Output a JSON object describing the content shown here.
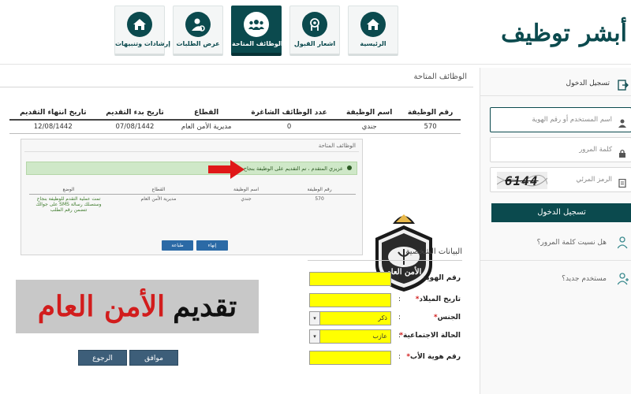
{
  "logo": {
    "part1": "أبشر",
    "part2": "توظيف"
  },
  "nav": [
    {
      "label": "الرئيسية",
      "icon": "home-icon"
    },
    {
      "label": "اشعار القبول",
      "icon": "head-icon"
    },
    {
      "label": "الوظائف المتاحة",
      "icon": "group-icon",
      "active": true
    },
    {
      "label": "عرض الطلبات",
      "icon": "user-settings-icon"
    },
    {
      "label": "إرشادات وتنبيهات",
      "icon": "home-icon"
    }
  ],
  "main": {
    "title": "الوظائف المتاحة",
    "table": {
      "headers": [
        "رقم الوظيفة",
        "اسم الوظيفة",
        "عدد الوظائف الشاغرة",
        "القطاع",
        "تاريخ بدء التقديم",
        "تاريخ انتهاء التقديم"
      ],
      "row": [
        "570",
        "جندي",
        "0",
        "مديرية الأمن العام",
        "07/08/1442",
        "12/08/1442"
      ]
    }
  },
  "inner": {
    "title": "الوظائف المتاحة",
    "success": "عزيزي المتقدم ، تم التقديم على الوظيفة بنجاح",
    "headers": [
      "رقم الوظيفة",
      "اسم الوظيفة",
      "القطاع",
      "الوضع"
    ],
    "row": [
      "570",
      "جندي",
      "مديرية الأمن العام",
      "تمت عملية التقدم للوظيفة بنجاح وستصلك رسالة SMS على جوالك تتضمن رقم الطلب"
    ],
    "btn_finish": "إنهاء",
    "btn_print": "طباعة"
  },
  "badge": {
    "text": "الأمن العام"
  },
  "banner": {
    "word1": "تقديم",
    "word2": "الأمن العام"
  },
  "form": {
    "title": "البيانات الشخصية",
    "fields": [
      {
        "label": "رقم الهوية",
        "required": false,
        "value": ""
      },
      {
        "label": "تاريخ الميلاد",
        "required": true,
        "value": ""
      },
      {
        "label": "الجنس",
        "required": true,
        "value": "ذكر"
      },
      {
        "label": "الحالة الاجتماعية",
        "required": true,
        "value": "عازب"
      },
      {
        "label": "رقم هوية الأب",
        "required": true,
        "value": ""
      }
    ],
    "colon": ":",
    "req_mark": "*",
    "btn_agree": "موافق",
    "btn_back": "الرجوع"
  },
  "login": {
    "title": "تسجيل الدخول",
    "username_placeholder": "اسم المستخدم أو رقم الهوية",
    "password_placeholder": "كلمة المرور",
    "captcha_placeholder": "الرمز المرئي",
    "captcha_text": "6144",
    "login_button": "تسجيل الدخول",
    "forgot_password": "هل نسيت كلمة المرور؟",
    "new_user": "مستخدم جديد؟"
  },
  "colors": {
    "brand": "#0b4a4e",
    "field_highlight": "#ffff00",
    "banner_red": "#d21d1d",
    "success_bg": "#cfe8c8"
  }
}
